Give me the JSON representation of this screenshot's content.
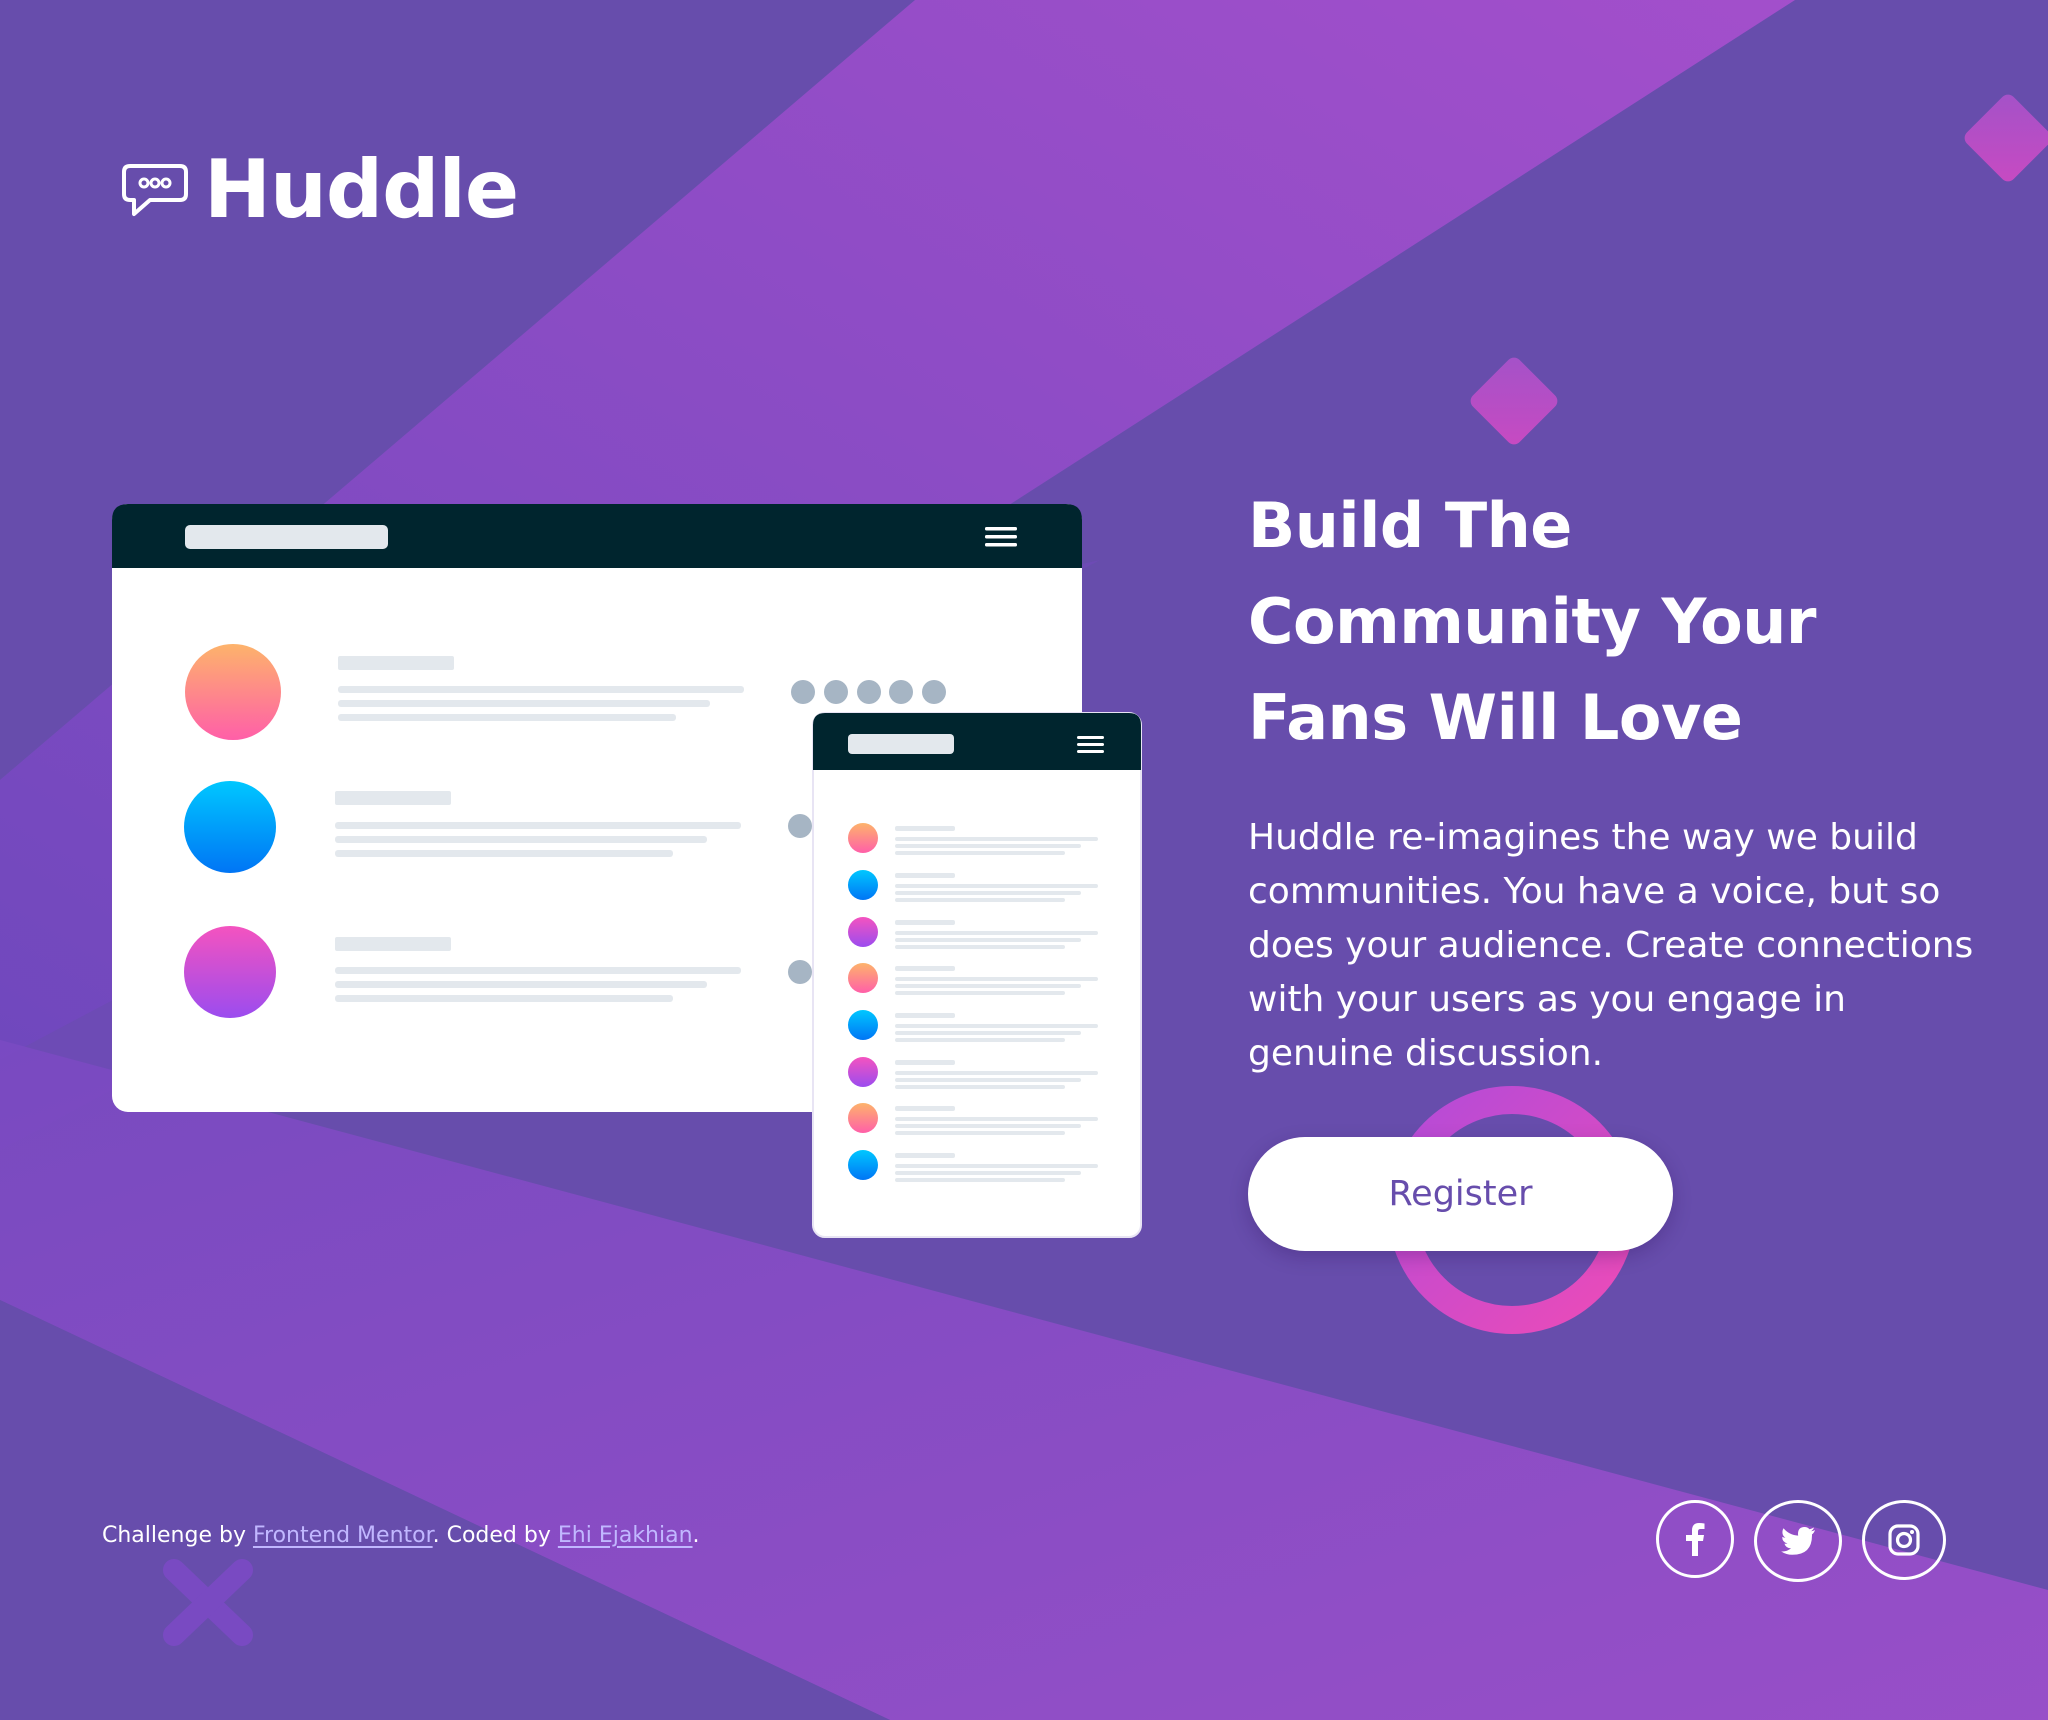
{
  "brand": {
    "name": "Huddle",
    "logo_icon": "chat-bubble-icon"
  },
  "hero": {
    "title_line1": "Build The",
    "title_line2": "Community Your",
    "title_line3": "Fans Will Love",
    "description": "Huddle re-imagines the way we build communities. You have a voice, but so does your audience. Create connections with your users as you engage in genuine discussion.",
    "register_label": "Register"
  },
  "footer": {
    "credit_prefix": "Challenge by ",
    "credit_link1": "Frontend Mentor",
    "credit_middle": ". Coded by ",
    "credit_link2": "Ehi Ejakhian",
    "credit_suffix": "."
  },
  "socials": [
    {
      "name": "facebook",
      "icon": "facebook-icon"
    },
    {
      "name": "twitter",
      "icon": "twitter-icon"
    },
    {
      "name": "instagram",
      "icon": "instagram-icon"
    }
  ],
  "colors": {
    "background": "#674DAC",
    "band": "#8A4FC6",
    "accent_pink": "#E349C6",
    "mockup_header": "#00252E",
    "register_text": "#674DAC",
    "link": "#C1B7FF"
  }
}
